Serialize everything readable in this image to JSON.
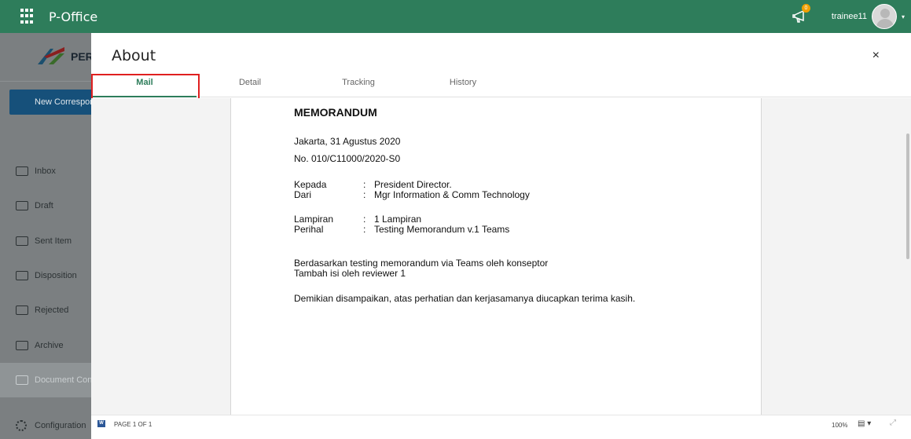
{
  "app": {
    "title": "P-Office",
    "apps_icon": "grid-icon"
  },
  "header": {
    "notification_count": "0",
    "notification_icon": "megaphone-icon",
    "username": "trainee11",
    "caret": "▾"
  },
  "sidebar": {
    "brand": "PER",
    "new_button_label": "New Correspondence",
    "items": [
      {
        "label": "Inbox",
        "icon": "inbox-icon"
      },
      {
        "label": "Draft",
        "icon": "draft-icon"
      },
      {
        "label": "Sent Item",
        "icon": "sent-icon"
      },
      {
        "label": "Disposition",
        "icon": "disposition-icon"
      },
      {
        "label": "Rejected",
        "icon": "rejected-icon"
      },
      {
        "label": "Archive",
        "icon": "archive-icon"
      },
      {
        "label": "Document Control",
        "icon": "document-icon",
        "active": true
      }
    ],
    "configuration_label": "Configuration"
  },
  "modal": {
    "title": "About",
    "close_label": "×",
    "tabs": [
      {
        "label": "Mail",
        "active": true
      },
      {
        "label": "Detail"
      },
      {
        "label": "Tracking"
      },
      {
        "label": "History"
      }
    ]
  },
  "document": {
    "heading": "MEMORANDUM",
    "place_date": "Jakarta, 31 Agustus 2020",
    "number": "No. 010/C11000/2020-S0",
    "to_label": "Kepada",
    "to_value": "President Director.",
    "from_label": "Dari",
    "from_value": "Mgr Information & Comm Technology",
    "attachment_label": "Lampiran",
    "attachment_value": "1 Lampiran",
    "subject_label": "Perihal",
    "subject_value": "Testing Memorandum v.1 Teams",
    "colon": ":",
    "body_1": "Berdasarkan testing memorandum via Teams oleh konseptor",
    "body_2": "Tambah isi oleh reviewer 1",
    "closing": "Demikian disampaikan, atas perhatian dan kerjasamanya diucapkan terima kasih."
  },
  "statusbar": {
    "word_icon": "W",
    "page_indicator": "PAGE 1 OF 1",
    "zoom": "100%",
    "view_icon": "▤ ▾",
    "fit_icon": "⤢"
  },
  "colors": {
    "primary": "#2e7d5b",
    "highlight": "#e02020",
    "new_button": "#16507a"
  }
}
